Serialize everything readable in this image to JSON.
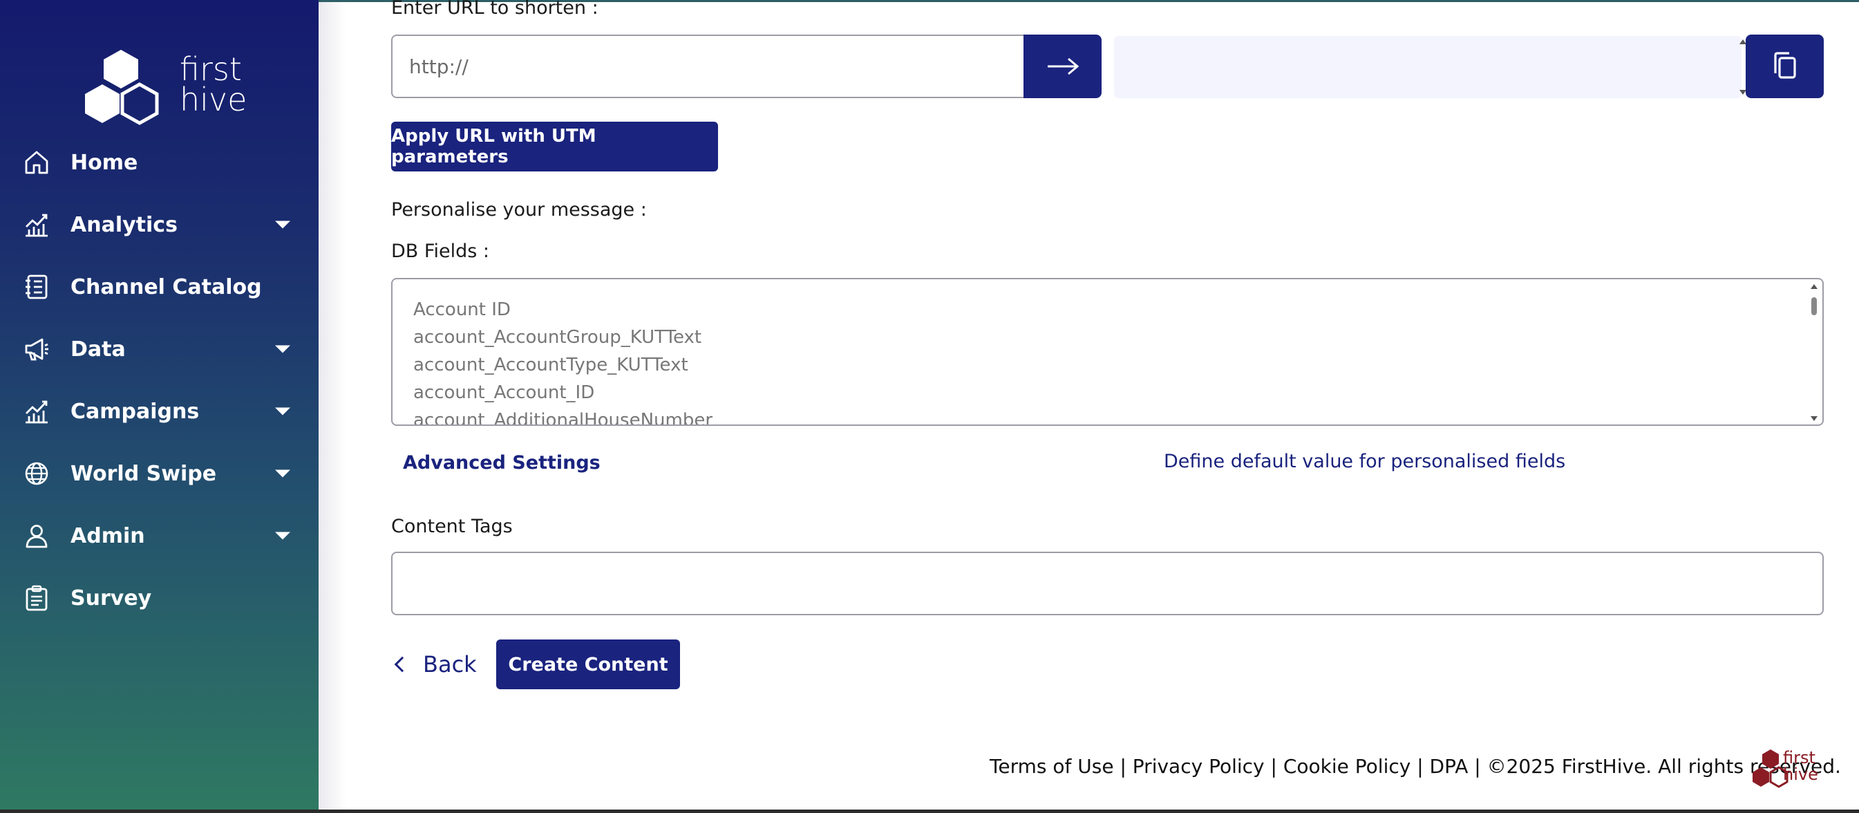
{
  "brand": {
    "logo_line1": "first",
    "logo_line2": "hive"
  },
  "sidebar": {
    "items": [
      {
        "label": "Home",
        "icon": "home-icon",
        "has_caret": false
      },
      {
        "label": "Analytics",
        "icon": "analytics-icon",
        "has_caret": true
      },
      {
        "label": "Channel Catalog",
        "icon": "catalog-icon",
        "has_caret": false
      },
      {
        "label": "Data",
        "icon": "megaphone-icon",
        "has_caret": true
      },
      {
        "label": "Campaigns",
        "icon": "campaigns-icon",
        "has_caret": true
      },
      {
        "label": "World Swipe",
        "icon": "globe-icon",
        "has_caret": true
      },
      {
        "label": "Admin",
        "icon": "user-icon",
        "has_caret": true
      },
      {
        "label": "Survey",
        "icon": "clipboard-icon",
        "has_caret": false
      }
    ]
  },
  "url_shortener": {
    "label": "Enter URL to shorten :",
    "input_value": "http://",
    "go_icon": "arrow-right-icon",
    "copy_icon": "copy-icon"
  },
  "utm_button_label": "Apply URL with UTM parameters",
  "personalise_label": "Personalise your message :",
  "db_fields": {
    "label": "DB Fields :",
    "items": [
      "Account ID",
      "account_AccountGroup_KUTText",
      "account_AccountType_KUTText",
      "account_Account_ID",
      "account_AdditionalHouseNumber"
    ]
  },
  "advanced_settings_label": "Advanced Settings",
  "define_default_label": "Define default value for personalised fields",
  "content_tags_label": "Content Tags",
  "back_label": "Back",
  "create_content_label": "Create Content",
  "footer": {
    "text": "Terms of Use | Privacy Policy | Cookie Policy | DPA | ©2025 FirstHive. All rights reserved.",
    "logo_line1": "first",
    "logo_line2": "hive"
  },
  "colors": {
    "primary": "#1a237e",
    "sidebar_top": "#141a6e",
    "sidebar_bottom": "#2f7a62",
    "footer_logo": "#8b1c24"
  }
}
